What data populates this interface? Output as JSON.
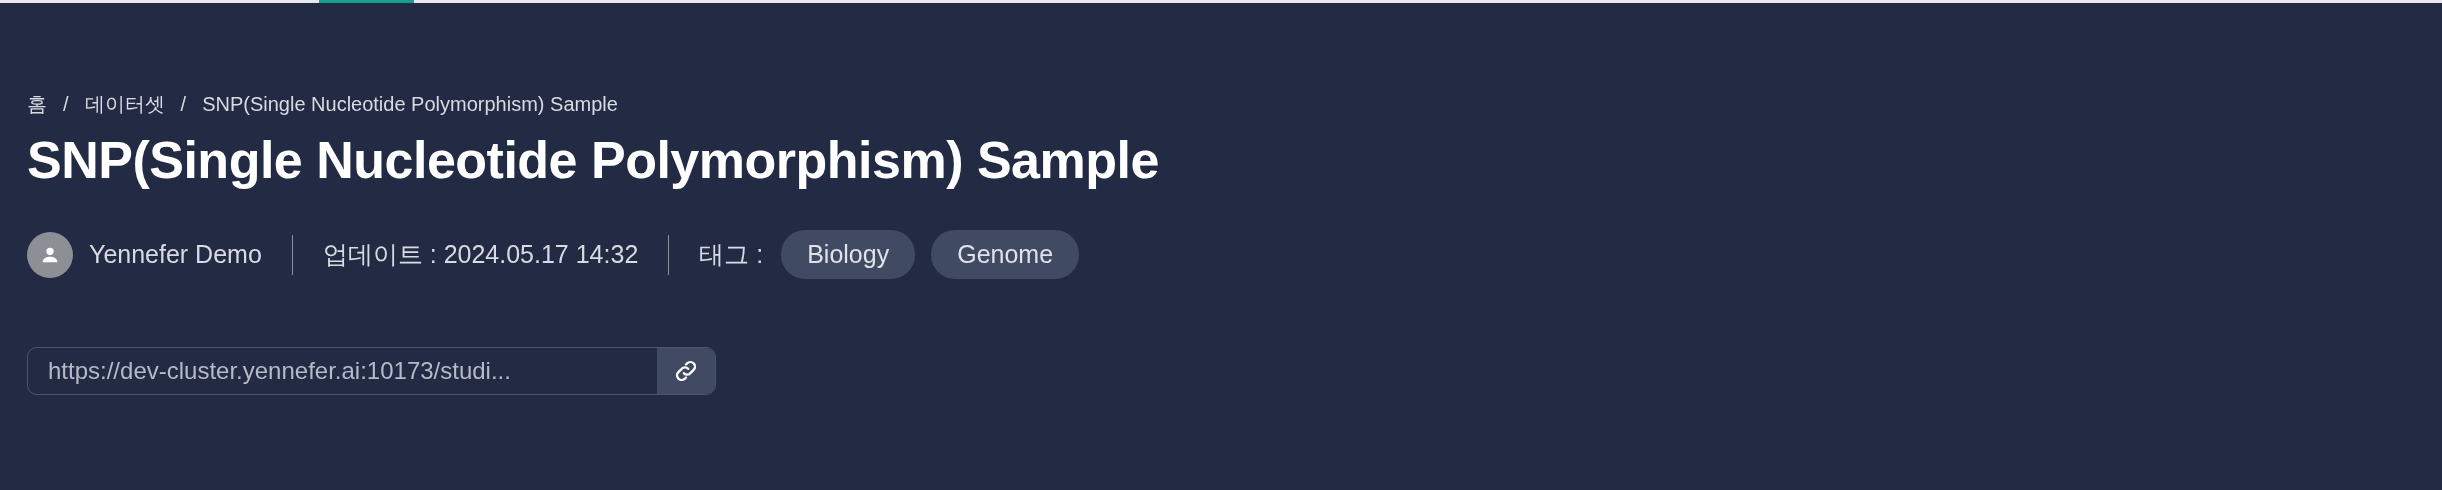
{
  "breadcrumb": [
    {
      "label": "홈"
    },
    {
      "label": "데이터셋"
    },
    {
      "label": "SNP(Single Nucleotide Polymorphism) Sample"
    }
  ],
  "breadcrumb_separator": "/",
  "title": "SNP(Single Nucleotide Polymorphism) Sample",
  "meta": {
    "author": "Yennefer Demo",
    "updated": "업데이트 : 2024.05.17 14:32",
    "tags_label": "태그 :",
    "tags": [
      "Biology",
      "Genome"
    ]
  },
  "link": {
    "value": "https://dev-cluster.yennefer.ai:10173/studi..."
  }
}
